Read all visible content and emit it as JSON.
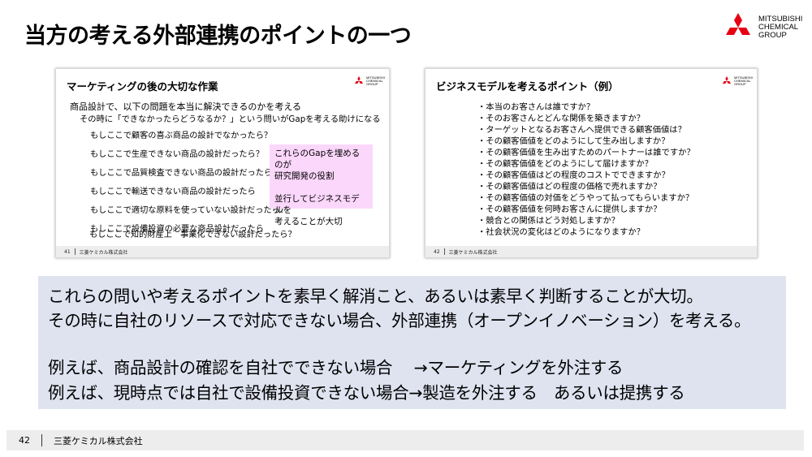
{
  "page": {
    "title": "当方の考える外部連携のポイントの一つ"
  },
  "logo": {
    "icon": "mitsubishi-three-diamonds",
    "brand_color": "#e60012",
    "lines": [
      "MITSUBISHI",
      "CHEMICAL",
      "GROUP"
    ]
  },
  "slide_left": {
    "title": "マーケティングの後の大切な作業",
    "intro": [
      "商品設計で、以下の問題を本当に解決できるのかを考える",
      "その時に「できなかったらどうなるか？」という問いがGapを考える助けになる"
    ],
    "items": [
      "もしここで顧客の喜ぶ商品の設計でなかったら？",
      "もしここで生産できない商品の設計だったら？",
      "もしここで品質検査できない商品の設計だったら？",
      "もしここで輸送できない商品の設計だったら",
      "もしここで適切な原料を使っていない設計だったら？",
      "もしここで設備投資の必要な商品設計だったら",
      "もしここで知的財産上　事業化できない設計だったら？"
    ],
    "callout": [
      "これらのGapを埋めるのが",
      "研究開発の役割",
      "",
      "並行してビジネスモデルを",
      "考えることが大切"
    ],
    "callout_color": "#fbd7fb",
    "footer_page": "41",
    "footer_company": "三菱ケミカル株式会社"
  },
  "slide_right": {
    "title": "ビジネスモデルを考えるポイント（例）",
    "items": [
      "・本当のお客さんは誰ですか？",
      "・そのお客さんとどんな関係を築きますか？",
      "・ターゲットとなるお客さんへ提供できる顧客価値は？",
      "・その顧客価値をどのようにして生み出しますか？",
      "・その顧客価値を生み出すためのパートナーは誰ですか？",
      "・その顧客価値をどのようにして届けますか？",
      "・その顧客価値はどの程度のコストでできますか？",
      "・その顧客価値はどの程度の価格で売れますか？",
      "・その顧客価値の対価をどうやって払ってもらいますか？",
      "・その顧客価値を何時お客さんに提供しますか？",
      "・競合との関係はどう対処しますか？",
      "・社会状況の変化はどのようになりますか？"
    ],
    "footer_page": "42",
    "footer_company": "三菱ケミカル株式会社"
  },
  "summary": {
    "box_color": "#dfe3f0",
    "lines": [
      "これらの問いや考えるポイントを素早く解消こと、あるいは素早く判断することが大切。",
      "その時に自社のリソースで対応できない場合、外部連携（オープンイノベーション）を考える。",
      "",
      "例えば、商品設計の確認を自社でできない場合　 →マーケティングを外注する",
      "例えば、現時点では自社で設備投資できない場合→製造を外注する　あるいは提携する"
    ]
  },
  "footer": {
    "page_number": "42",
    "company": "三菱ケミカル株式会社"
  }
}
